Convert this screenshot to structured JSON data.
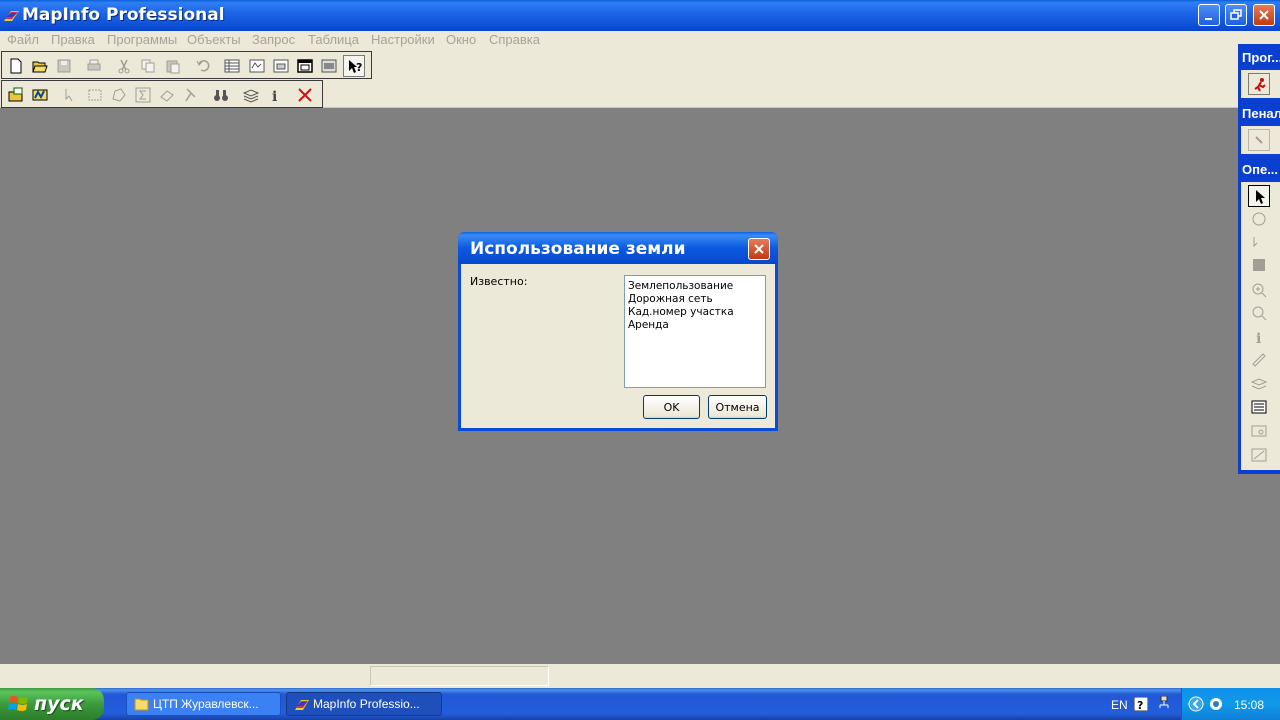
{
  "window": {
    "title": "MapInfo Professional"
  },
  "menu": [
    "Файл",
    "Правка",
    "Программы",
    "Объекты",
    "Запрос",
    "Таблица",
    "Настройки",
    "Окно",
    "Справка"
  ],
  "palettes": [
    {
      "title": "Прог..."
    },
    {
      "title": "Пенал"
    },
    {
      "title": "Опе..."
    }
  ],
  "dialog": {
    "title": "Использование земли",
    "label": "Известно:",
    "list_items": [
      "Землепользование",
      "Дорожная сеть",
      "Кад.номер участка",
      "Аренда"
    ],
    "ok_label": "OK",
    "cancel_label": "Отмена"
  },
  "taskbar": {
    "start_label": "пуск",
    "tasks": [
      {
        "label": "ЦТП Журавлевск...",
        "icon": "folder-icon"
      },
      {
        "label": "MapInfo Professio...",
        "icon": "mapinfo-icon"
      }
    ],
    "language": "EN",
    "clock": "15:08"
  },
  "colors": {
    "titlebar": "#0a5fd8",
    "workspace": "#808080",
    "chrome": "#ece9d8",
    "start": "#3c9a3c"
  }
}
